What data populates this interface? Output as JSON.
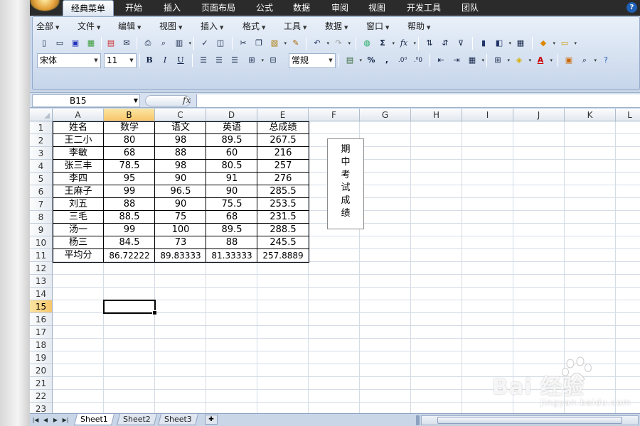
{
  "ribbon": {
    "tabs": [
      "经典菜单",
      "开始",
      "插入",
      "页面布局",
      "公式",
      "数据",
      "审阅",
      "视图",
      "开发工具",
      "团队"
    ],
    "active_tab": "经典菜单",
    "help": "?"
  },
  "menu": {
    "items": [
      "全部",
      "文件",
      "编辑",
      "视图",
      "插入",
      "格式",
      "工具",
      "数据",
      "窗口",
      "帮助"
    ]
  },
  "toolbar": {
    "font_name": "宋体",
    "font_size": "11",
    "number_format": "常规",
    "bold": "B",
    "italic": "I",
    "underline": "U",
    "percent": "%",
    "comma": ",",
    "sigma": "Σ",
    "fx": "fx"
  },
  "formula_bar": {
    "name_box": "B15",
    "fx_label": "fx",
    "content": ""
  },
  "sheet": {
    "columns": [
      "A",
      "B",
      "C",
      "D",
      "E",
      "F",
      "G",
      "H",
      "I",
      "J",
      "K",
      "L"
    ],
    "selected_column": "B",
    "rows": [
      "1",
      "2",
      "3",
      "4",
      "5",
      "6",
      "7",
      "8",
      "9",
      "10",
      "11",
      "12",
      "13",
      "14",
      "15",
      "16",
      "17",
      "18",
      "19",
      "20",
      "21",
      "22",
      "23"
    ],
    "selected_row": "15",
    "active_cell": "B15",
    "headers": [
      "姓名",
      "数学",
      "语文",
      "英语",
      "总成绩"
    ],
    "data": [
      [
        "王二小",
        "80",
        "98",
        "89.5",
        "267.5"
      ],
      [
        "李敏",
        "68",
        "88",
        "60",
        "216"
      ],
      [
        "张三丰",
        "78.5",
        "98",
        "80.5",
        "257"
      ],
      [
        "李四",
        "95",
        "90",
        "91",
        "276"
      ],
      [
        "王麻子",
        "99",
        "96.5",
        "90",
        "285.5"
      ],
      [
        "刘五",
        "88",
        "90",
        "75.5",
        "253.5"
      ],
      [
        "三毛",
        "88.5",
        "75",
        "68",
        "231.5"
      ],
      [
        "汤一",
        "99",
        "100",
        "89.5",
        "288.5"
      ],
      [
        "杨三",
        "84.5",
        "73",
        "88",
        "245.5"
      ]
    ],
    "average_row": [
      "平均分",
      "86.72222",
      "89.83333",
      "81.33333",
      "257.8889"
    ],
    "textbox_chars": [
      "期",
      "中",
      "考",
      "试",
      "成",
      "绩"
    ]
  },
  "sheet_tabs": {
    "tabs": [
      "Sheet1",
      "Sheet2",
      "Sheet3"
    ],
    "active": "Sheet1"
  },
  "watermark": {
    "brand": "Bai  经验",
    "url": "jingyan.baidu.com"
  }
}
